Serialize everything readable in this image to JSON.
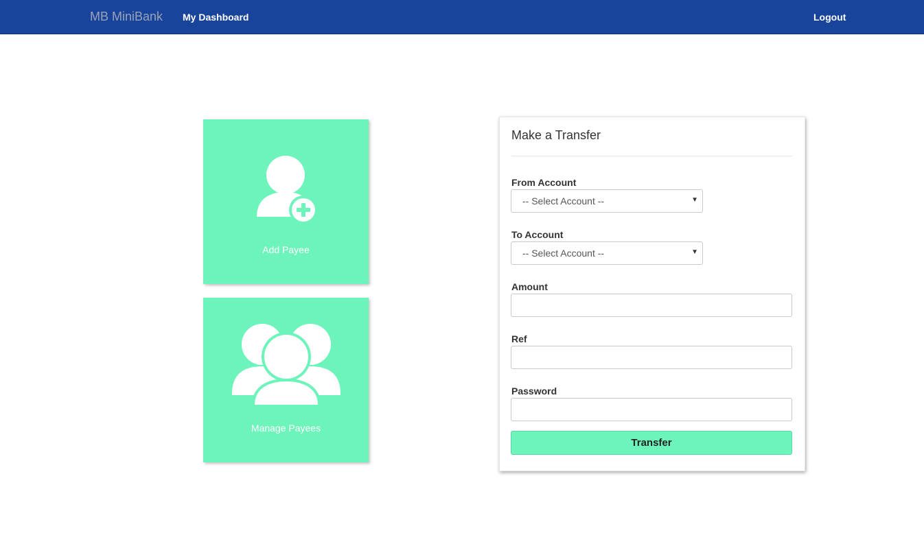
{
  "navbar": {
    "brand": "MB MiniBank",
    "dashboard_link": "My Dashboard",
    "logout_link": "Logout",
    "background_color": "#18449c"
  },
  "tiles": {
    "add_payee": {
      "label": "Add Payee",
      "icon": "add-user-icon"
    },
    "manage_payees": {
      "label": "Manage Payees",
      "icon": "users-group-icon"
    },
    "color": "#6df4bb"
  },
  "transfer_form": {
    "title": "Make a Transfer",
    "from_account": {
      "label": "From Account",
      "selected": "-- Select Account --"
    },
    "to_account": {
      "label": "To Account",
      "selected": "-- Select Account --"
    },
    "amount": {
      "label": "Amount",
      "value": ""
    },
    "ref": {
      "label": "Ref",
      "value": ""
    },
    "password": {
      "label": "Password",
      "value": ""
    },
    "submit_label": "Transfer"
  }
}
